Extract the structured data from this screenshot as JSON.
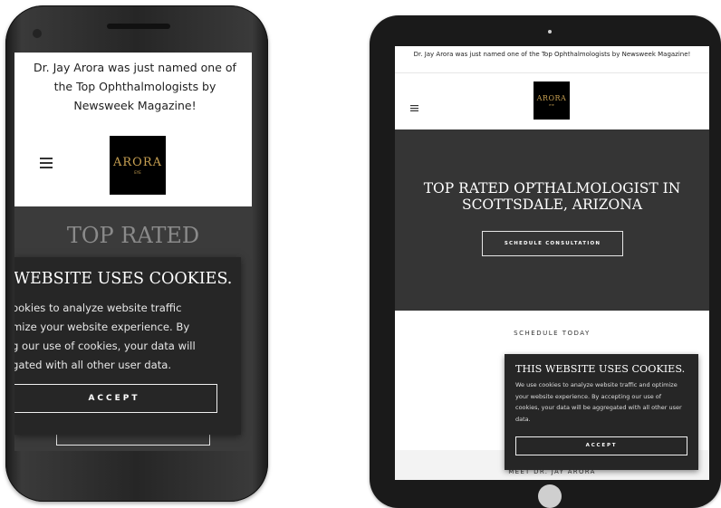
{
  "announcement": "Dr. Jay Arora was just named one of the Top Ophthalmologists by Newsweek Magazine!",
  "logo": {
    "text": "ARORA",
    "sub": "EYE"
  },
  "hero": {
    "title": "TOP RATED OPTHALMOLOGIST IN SCOTTSDALE, ARIZONA",
    "cta_label": "SCHEDULE CONSULTATION",
    "phone_title_fragment": "TOP RATED"
  },
  "schedule_heading": "SCHEDULE TODAY",
  "meet_heading": "MEET DR. JAY ARORA",
  "cookie": {
    "title": "THIS WEBSITE USES COOKIES.",
    "body": "We use cookies to analyze website traffic and optimize your website experience. By accepting our use of cookies, your data will be aggregated with all other user data.",
    "accept_label": "ACCEPT"
  },
  "phone_cookie": {
    "title": "WEBSITE USES COOKIES.",
    "body_lines": [
      "ookies to analyze website traffic",
      "mize your website experience. By",
      "g our use of cookies, your data will",
      "gated with all other user data."
    ]
  },
  "colors": {
    "hero_bg": "#353535",
    "cookie_bg": "#262626",
    "logo_gold": "#c7a052",
    "device_frame": "#1a1a1a"
  }
}
